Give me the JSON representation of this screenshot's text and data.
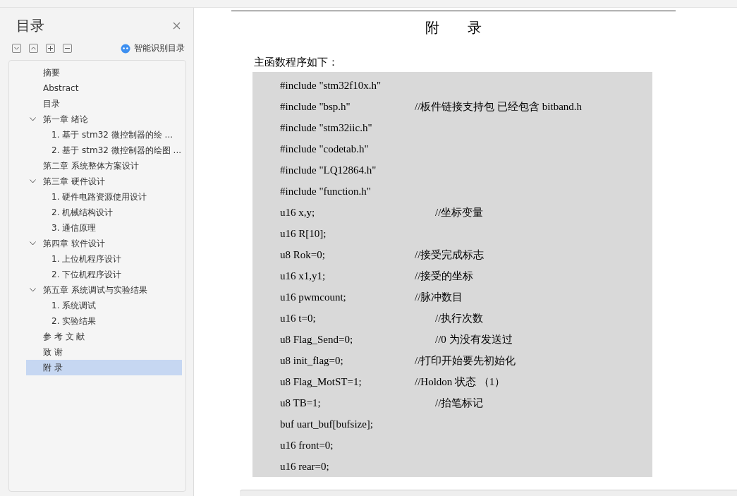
{
  "sidebar": {
    "title": "目录",
    "smart_button": "智能识别目录",
    "items": [
      {
        "label": "摘要",
        "selected": false
      },
      {
        "label": "Abstract",
        "selected": false
      },
      {
        "label": "目录",
        "selected": false
      },
      {
        "label": "第一章 绪论",
        "selected": false,
        "expanded": true,
        "children": [
          {
            "label": "1.  基于 stm32 微控制器的绘 ...",
            "selected": false
          },
          {
            "label": "2. 基于 stm32 微控制器的绘图 ...",
            "selected": false
          }
        ]
      },
      {
        "label": "第二章 系统整体方案设计",
        "selected": false
      },
      {
        "label": "第三章 硬件设计",
        "selected": false,
        "expanded": true,
        "children": [
          {
            "label": "1.  硬件电路资源使用设计",
            "selected": false
          },
          {
            "label": "2.  机械结构设计",
            "selected": false
          },
          {
            "label": "3.  通信原理",
            "selected": false
          }
        ]
      },
      {
        "label": "第四章 软件设计",
        "selected": false,
        "expanded": true,
        "children": [
          {
            "label": "1.  上位机程序设计",
            "selected": false
          },
          {
            "label": "2.  下位机程序设计",
            "selected": false
          }
        ]
      },
      {
        "label": "第五章 系统调试与实验结果",
        "selected": false,
        "expanded": true,
        "children": [
          {
            "label": "1.  系统调试",
            "selected": false
          },
          {
            "label": "2.  实验结果",
            "selected": false
          }
        ]
      },
      {
        "label": "参 考 文 献",
        "selected": false
      },
      {
        "label": "致 谢",
        "selected": false
      },
      {
        "label": "附 录",
        "selected": true
      }
    ]
  },
  "document": {
    "heading": "附　　录",
    "intro": "主函数程序如下：",
    "code_lines": [
      {
        "code": "#include \"stm32f10x.h\""
      },
      {
        "code": "#include \"bsp.h\"",
        "comment": "//板件链接支持包  已经包含 bitband.h",
        "indent": false
      },
      {
        "code": "#include \"stm32iic.h\""
      },
      {
        "code": "#include \"codetab.h\""
      },
      {
        "code": "#include \"LQ12864.h\""
      },
      {
        "code": "#include \"function.h\""
      },
      {
        "code": "u16 x,y;",
        "comment": "//坐标变量",
        "indent": true
      },
      {
        "code": "u16 R[10];"
      },
      {
        "code": "u8 Rok=0;",
        "comment": "//接受完成标志",
        "indent": false
      },
      {
        "code": "u16 x1,y1;",
        "comment": "//接受的坐标",
        "indent": false
      },
      {
        "code": "u16 pwmcount;",
        "comment": "//脉冲数目",
        "indent": false
      },
      {
        "code": "u16 t=0;",
        "comment": "//执行次数",
        "indent": true
      },
      {
        "code": "u8 Flag_Send=0;",
        "comment": "//0 为没有发送过",
        "indent": true
      },
      {
        "code": "u8 init_flag=0;",
        "comment": "//打印开始要先初始化",
        "indent": false
      },
      {
        "code": "u8 Flag_MotST=1;",
        "comment": "//Holdon  状态   （1）",
        "indent": false
      },
      {
        "code": "u8 TB=1;",
        "comment": "//抬笔标记",
        "indent": true
      },
      {
        "code": "buf uart_buf[bufsize];"
      },
      {
        "code": "u16 front=0;"
      },
      {
        "code": "u16 rear=0;"
      }
    ]
  }
}
